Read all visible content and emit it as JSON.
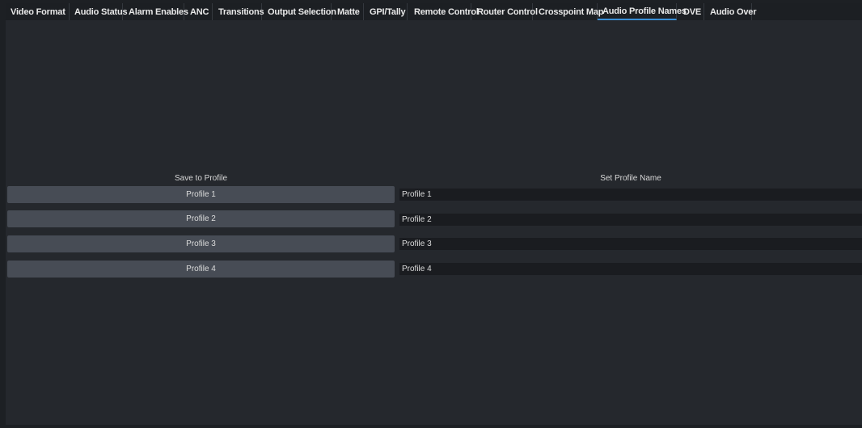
{
  "tabs": [
    {
      "label": "Video Format"
    },
    {
      "label": "Audio Status"
    },
    {
      "label": "Alarm Enables"
    },
    {
      "label": "ANC"
    },
    {
      "label": "Transitions"
    },
    {
      "label": "Output Selection"
    },
    {
      "label": "Matte"
    },
    {
      "label": "GPI/Tally"
    },
    {
      "label": "Remote Control"
    },
    {
      "label": "Router Control"
    },
    {
      "label": "Crosspoint Map"
    },
    {
      "label": "Audio Profile Names"
    },
    {
      "label": "DVE"
    },
    {
      "label": "Audio Over"
    }
  ],
  "active_tab": "Audio Profile Names",
  "colors": {
    "accent": "#3a8fd6",
    "panel": "#25282d",
    "button": "#474c55",
    "field": "#1a1c20"
  },
  "save_column": {
    "header": "Save to Profile",
    "buttons": [
      "Profile 1",
      "Profile 2",
      "Profile 3",
      "Profile 4"
    ]
  },
  "name_column": {
    "header": "Set Profile Name",
    "fields": [
      "Profile 1",
      "Profile 2",
      "Profile 3",
      "Profile 4"
    ]
  }
}
